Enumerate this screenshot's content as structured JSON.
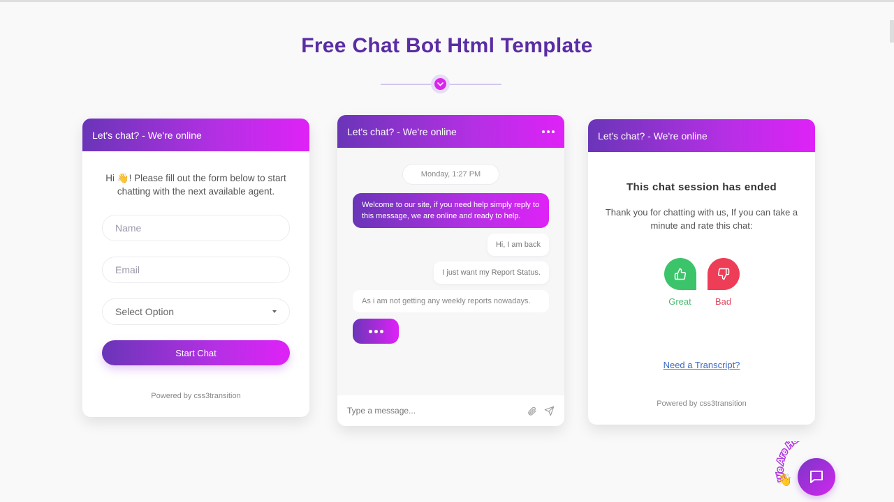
{
  "page": {
    "title": "Free Chat Bot Html Template"
  },
  "colors": {
    "gradient_start": "#6a35b8",
    "gradient_end": "#df22f7",
    "title": "#5a2da3",
    "great": "#3cc46a",
    "bad": "#ee3d57",
    "link": "#3b6ac4"
  },
  "form_card": {
    "header": "Let's chat? - We're online",
    "intro_prefix": "Hi ",
    "intro_emoji": "👋",
    "intro_suffix": "! Please fill out the form below to start chatting with the next available agent.",
    "name_placeholder": "Name",
    "email_placeholder": "Email",
    "select_value": "Select Option",
    "start_button": "Start Chat",
    "powered_by": "Powered by css3transition"
  },
  "chat_card": {
    "header": "Let's chat? - We're online",
    "timestamp": "Monday, 1:27 PM",
    "messages": [
      {
        "from": "bot",
        "text": "Welcome to our site, if you need help simply reply to this message, we are online and ready to help."
      },
      {
        "from": "user",
        "text": "Hi, I am back"
      },
      {
        "from": "user",
        "text": "I just want my Report Status."
      },
      {
        "from": "user",
        "text": "As i am not getting any weekly reports nowadays."
      }
    ],
    "composer_placeholder": "Type a message..."
  },
  "ended_card": {
    "header": "Let's chat? - We're online",
    "title": "This chat session has ended",
    "text": "Thank you for chatting with us, If you can take a minute and rate this chat:",
    "great_label": "Great",
    "bad_label": "Bad",
    "transcript_link": "Need a Transcript?",
    "powered_by": "Powered by css3transition"
  },
  "fab": {
    "label": "We Are Here!",
    "emoji": "👋"
  }
}
